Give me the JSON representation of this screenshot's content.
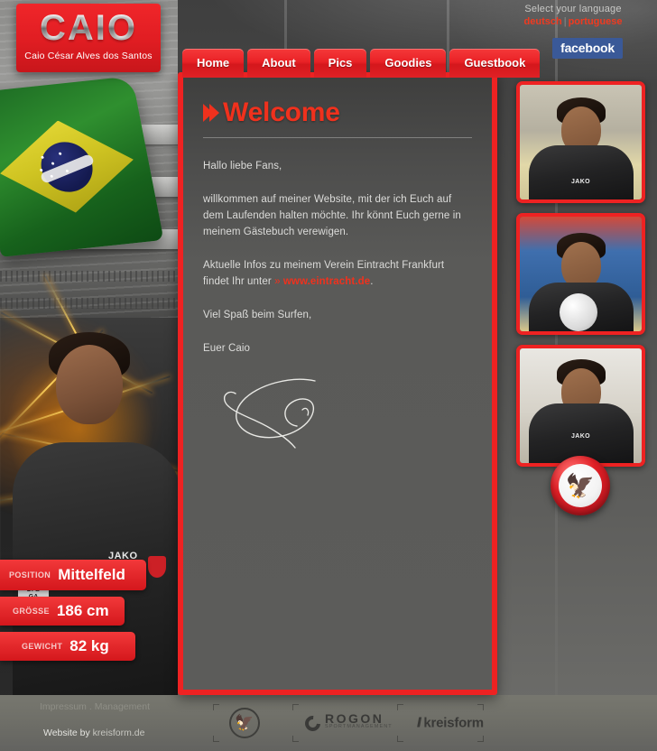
{
  "site": {
    "logo_title": "CAIO",
    "logo_subtitle": "Caio César Alves dos Santos"
  },
  "language": {
    "prompt": "Select your language",
    "options": [
      "deutsch",
      "portuguese"
    ],
    "separator": "|",
    "accent_color": "#f03a20"
  },
  "social": {
    "facebook_label": "facebook",
    "facebook_color": "#3a5998"
  },
  "nav": {
    "items": [
      {
        "label": "Home"
      },
      {
        "label": "About"
      },
      {
        "label": "Pics"
      },
      {
        "label": "Goodies"
      },
      {
        "label": "Guestbook"
      }
    ],
    "accent_color": "#e92226"
  },
  "content": {
    "heading": "Welcome",
    "heading_icon": "double-chevron-right-icon",
    "paragraphs": [
      "Hallo liebe Fans,",
      "willkommen auf meiner Website, mit der ich Euch auf dem Laufenden halten möchte. Ihr könnt Euch gerne in meinem Gästebuch verewigen.",
      "Viel Spaß beim Surfen,",
      "Euer Caio"
    ],
    "link_paragraph": {
      "before": "Aktuelle Infos zu meinem Verein Eintracht Frankfurt findet Ihr unter ",
      "arrow": "»",
      "link_text": "www.eintracht.de",
      "after": "."
    },
    "signature_alt": "Caio signature"
  },
  "player_stats": [
    {
      "label": "POSITION",
      "value": "Mittelfeld"
    },
    {
      "label": "GRÖSSE",
      "value": "186 cm"
    },
    {
      "label": "GEWICHT",
      "value": "82 kg"
    }
  ],
  "gallery": {
    "photos": [
      {
        "caption": "Caio portrait in stadium stands"
      },
      {
        "caption": "Caio holding a football"
      },
      {
        "caption": "Caio smiling in training kit"
      }
    ],
    "club_badge": "eintracht-frankfurt-crest"
  },
  "footer": {
    "links": [
      {
        "label": "Impressum"
      },
      {
        "label": "Management"
      }
    ],
    "link_separator": ".",
    "credit_prefix": "Website by",
    "credit_link": "kreisform.de",
    "sponsors": [
      {
        "name": "Eintracht Frankfurt",
        "mark": "eagle-crest-icon"
      },
      {
        "name": "ROGON",
        "tagline": "SPORTMANAGEMENT"
      },
      {
        "name": "kreisform"
      }
    ]
  }
}
